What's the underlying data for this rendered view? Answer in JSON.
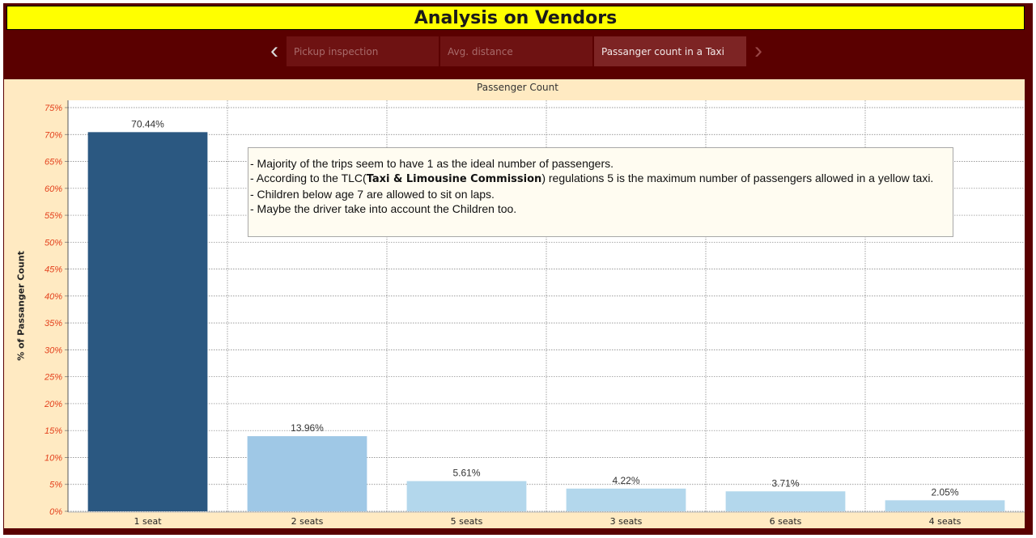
{
  "header": {
    "title": "Analysis on Vendors"
  },
  "navigation": {
    "prev_icon": "chevron-left-icon",
    "next_icon": "chevron-right-icon",
    "prev_glyph": "‹",
    "next_glyph": "›",
    "tabs": [
      {
        "label": "Pickup inspection",
        "active": false
      },
      {
        "label": "Avg. distance",
        "active": false
      },
      {
        "label": "Passanger count in a Taxi",
        "active": true
      }
    ]
  },
  "annotation": {
    "line1": "- Majority of the trips seem to have 1 as the ideal number of passengers.",
    "line2_prefix": "- According to the TLC(",
    "line2_bold": "Taxi & Limousine Commission",
    "line2_suffix": ") regulations 5 is the maximum number of passengers allowed in a yellow taxi.",
    "line3": "- Children below age 7 are allowed to sit on laps.",
    "line4": "- Maybe the driver take into account the Children too."
  },
  "colors": {
    "frame": "#5a0000",
    "title_background": "#ffff00",
    "chart_background": "#ffeac2",
    "bar_highlight": "#2b5881",
    "bar_secondary": "#9fc8e6",
    "bar_tertiary": "#b3d7ec",
    "y_tick_color": "#e3401c"
  },
  "chart_data": {
    "type": "bar",
    "title": "Passenger Count",
    "xlabel": "",
    "ylabel": "% of Passanger Count",
    "categories": [
      "1 seat",
      "2 seats",
      "5 seats",
      "3 seats",
      "6 seats",
      "4 seats"
    ],
    "values": [
      70.44,
      13.96,
      5.61,
      4.22,
      3.71,
      2.05
    ],
    "data_labels": [
      "70.44%",
      "13.96%",
      "5.61%",
      "4.22%",
      "3.71%",
      "2.05%"
    ],
    "bar_colors": [
      "#2b5881",
      "#9fc8e6",
      "#b3d7ec",
      "#b3d7ec",
      "#b3d7ec",
      "#b3d7ec"
    ],
    "yticks": [
      "0%",
      "5%",
      "10%",
      "15%",
      "20%",
      "25%",
      "30%",
      "35%",
      "40%",
      "45%",
      "50%",
      "55%",
      "60%",
      "65%",
      "70%",
      "75%"
    ],
    "ylim": [
      0,
      75
    ],
    "grid": true
  }
}
